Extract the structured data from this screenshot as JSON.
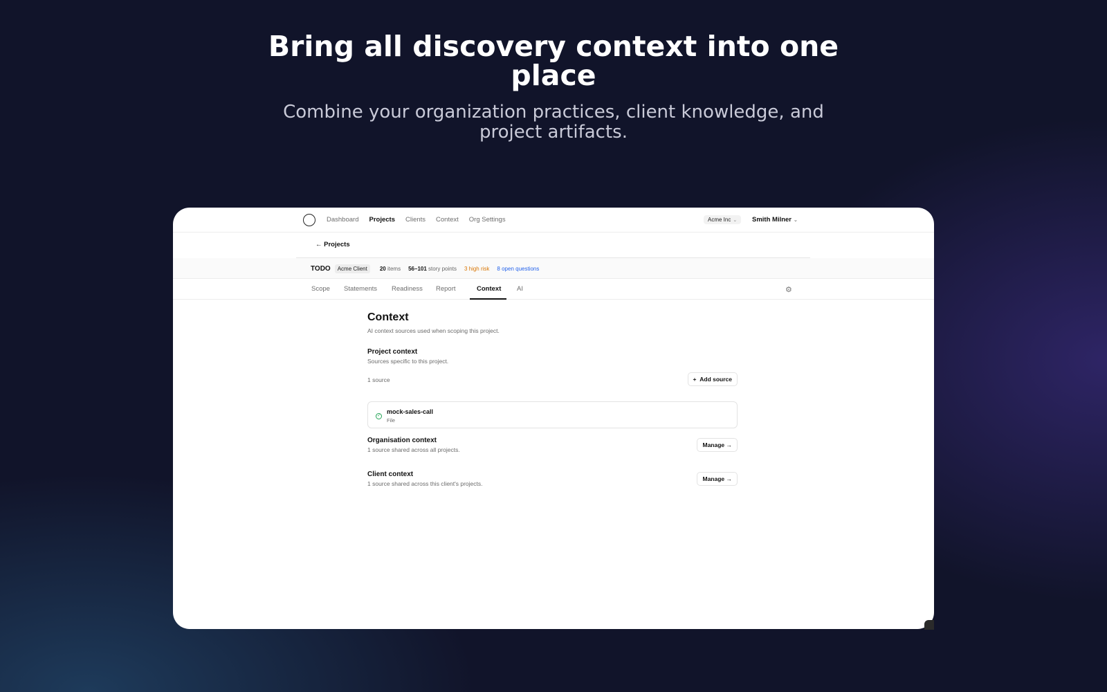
{
  "hero": {
    "title": "Bring all discovery context into one place",
    "subtitle": "Combine your organization practices, client knowledge, and project artifacts."
  },
  "nav": {
    "links": [
      "Dashboard",
      "Projects",
      "Clients",
      "Context",
      "Org Settings"
    ],
    "active_link": "Projects",
    "org_switcher": "Acme Inc",
    "user": "Smith Milner"
  },
  "back_link": "← Projects",
  "project": {
    "name": "TODO",
    "client": "Acme Client",
    "items_count": "20",
    "items_label": "items",
    "story_points_value": "56–101",
    "story_points_label": "story points",
    "high_risk": "3 high risk",
    "open_questions": "8 open questions"
  },
  "tabs": [
    "Scope",
    "Statements",
    "Readiness",
    "Report",
    "Context",
    "AI"
  ],
  "active_tab": "Context",
  "context": {
    "title": "Context",
    "subtitle": "AI context sources used when scoping this project.",
    "project_context": {
      "title": "Project context",
      "subtitle": "Sources specific to this project.",
      "source_count": "1 source",
      "add_button": "Add source",
      "sources": [
        {
          "name": "mock-sales-call",
          "type": "File",
          "status": "ready"
        }
      ]
    },
    "organisation_context": {
      "title": "Organisation context",
      "subtitle": "1 source shared across all projects.",
      "button": "Manage →"
    },
    "client_context": {
      "title": "Client context",
      "subtitle": "1 source shared across this client's projects.",
      "button": "Manage →"
    }
  },
  "icons": {
    "logo": "circle-logo-icon",
    "chevron": "chevron-down-icon",
    "settings": "gear-icon",
    "add": "plus-icon",
    "status": "check-circle-icon"
  },
  "colors": {
    "high_risk": "#d97706",
    "open_questions": "#2563eb",
    "status_ok": "#22a355"
  }
}
